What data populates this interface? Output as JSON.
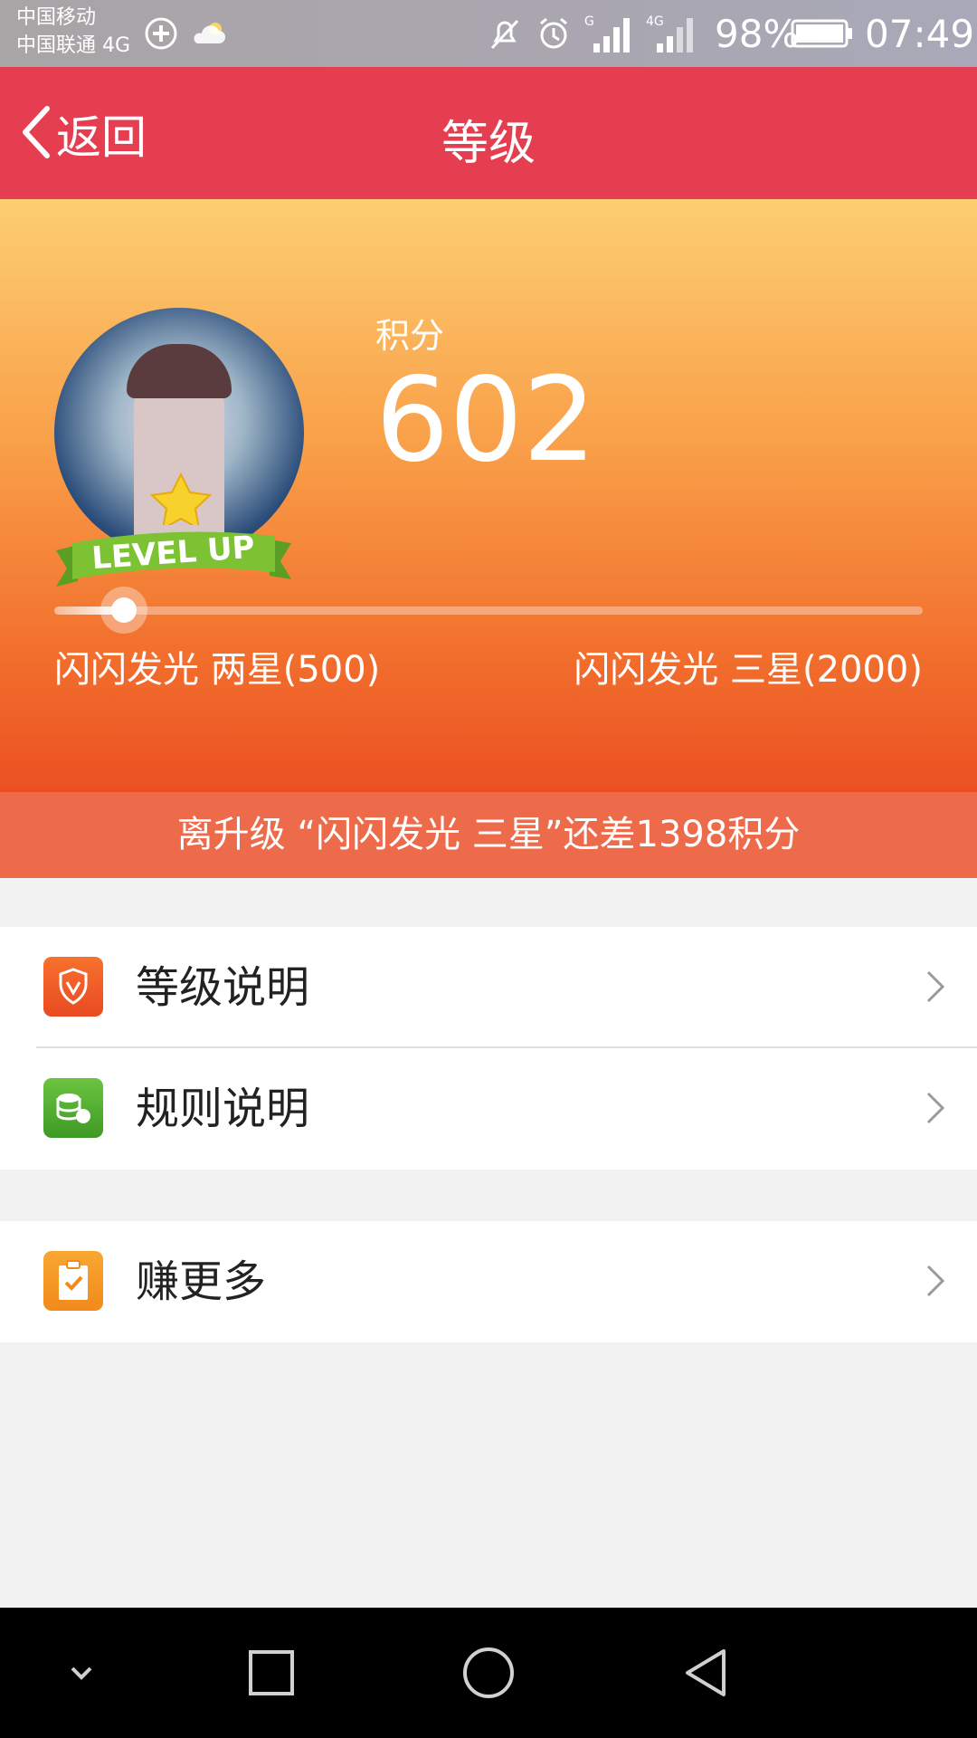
{
  "status_bar": {
    "carrier_1": "中国移动",
    "carrier_2": "中国联通 4G",
    "battery_percent": "98%",
    "time": "07:49",
    "icons": [
      "plus-circle-icon",
      "cloud-icon",
      "mute-icon",
      "alarm-icon",
      "signal-g-icon",
      "signal-4g-icon",
      "battery-icon"
    ]
  },
  "header": {
    "back_label": "返回",
    "title": "等级",
    "bg_color": "#e63e51"
  },
  "hero": {
    "avatar_badge_text": "LEVEL UP",
    "score_label": "积分",
    "score_value": "602",
    "progress": {
      "current": 602,
      "min": 500,
      "max": 2000,
      "knob_fraction": 0.08
    },
    "level_current": "闪闪发光 两星(500)",
    "level_next": "闪闪发光 三星(2000)"
  },
  "banner": {
    "text": "离升级 “闪闪发光 三星”还差1398积分",
    "bg_color": "#ed6a4b"
  },
  "menu": {
    "group1": [
      {
        "label": "等级说明",
        "icon": "shield-icon",
        "icon_color": "#f0542a"
      },
      {
        "label": "规则说明",
        "icon": "coins-icon",
        "icon_color": "#4caf35"
      }
    ],
    "group2": [
      {
        "label": "赚更多",
        "icon": "clipboard-check-icon",
        "icon_color": "#f7941d"
      }
    ]
  },
  "system_nav": {
    "buttons": [
      "collapse-icon",
      "recent-apps-icon",
      "home-icon",
      "back-triangle-icon"
    ]
  }
}
